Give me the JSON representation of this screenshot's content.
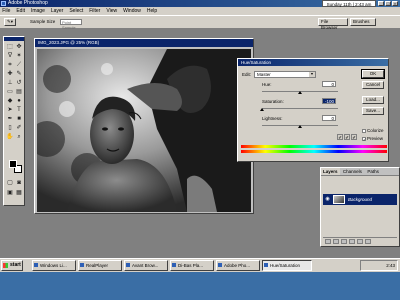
{
  "app": {
    "title": "Adobe Photoshop",
    "date_time": "Sunday 11th | 2:43 am",
    "window_controls": [
      "_",
      "□",
      "×"
    ]
  },
  "menu": [
    "File",
    "Edit",
    "Image",
    "Layer",
    "Select",
    "Filter",
    "View",
    "Window",
    "Help"
  ],
  "options_bar": {
    "sample_size_label": "Sample Size",
    "sample_size_value": "Point Sample",
    "file_browser": "File Browser",
    "brushes": "Brushes"
  },
  "document": {
    "title": "IMG_2023.JPG @ 25% (RGB)"
  },
  "hue_saturation": {
    "title": "Hue/Saturation",
    "edit_label": "Edit:",
    "edit_value": "Master",
    "hue_label": "Hue:",
    "hue_value": "0",
    "saturation_label": "Saturation:",
    "saturation_value": "-100",
    "lightness_label": "Lightness:",
    "lightness_value": "0",
    "buttons": {
      "ok": "OK",
      "cancel": "Cancel",
      "load": "Load...",
      "save": "Save..."
    },
    "colorize_label": "Colorize",
    "preview_label": "Preview",
    "colorize_checked": false,
    "preview_checked": true,
    "hue_fraction": 0.5,
    "saturation_fraction": 0.0,
    "lightness_fraction": 0.5
  },
  "palette_tabs": [
    "File Browser",
    "Brushes"
  ],
  "layers": {
    "tabs": [
      "Layers",
      "Channels",
      "Paths"
    ],
    "layer_name": "Background"
  },
  "taskbar": {
    "start": "start",
    "tasks": [
      "Windows Li...",
      "RealPlayer",
      "Avant Brow...",
      "Di-Bas Pla...",
      "Adobe Pho...",
      "Hue/Saturation"
    ],
    "clock": "2:43"
  }
}
